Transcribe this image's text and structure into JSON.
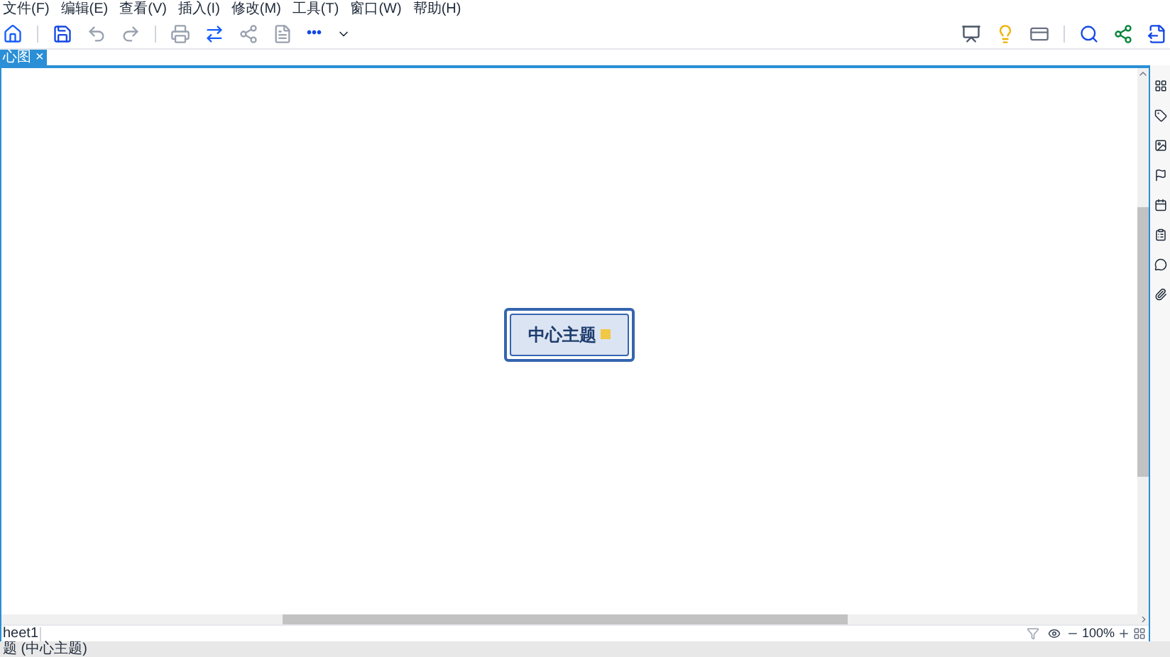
{
  "menu": [
    "文件(F)",
    "编辑(E)",
    "查看(V)",
    "插入(I)",
    "修改(M)",
    "工具(T)",
    "窗口(W)",
    "帮助(H)"
  ],
  "toolbar": {
    "more": "•••"
  },
  "tabs": [
    {
      "label": "心图",
      "selected": true,
      "close": "×"
    }
  ],
  "canvas": {
    "central_topic": "中心主题"
  },
  "sheets": [
    {
      "label": "heet1",
      "selected": true
    }
  ],
  "zoom": {
    "value": "100%"
  },
  "status_bar": {
    "text": "题 (中心主题)"
  }
}
